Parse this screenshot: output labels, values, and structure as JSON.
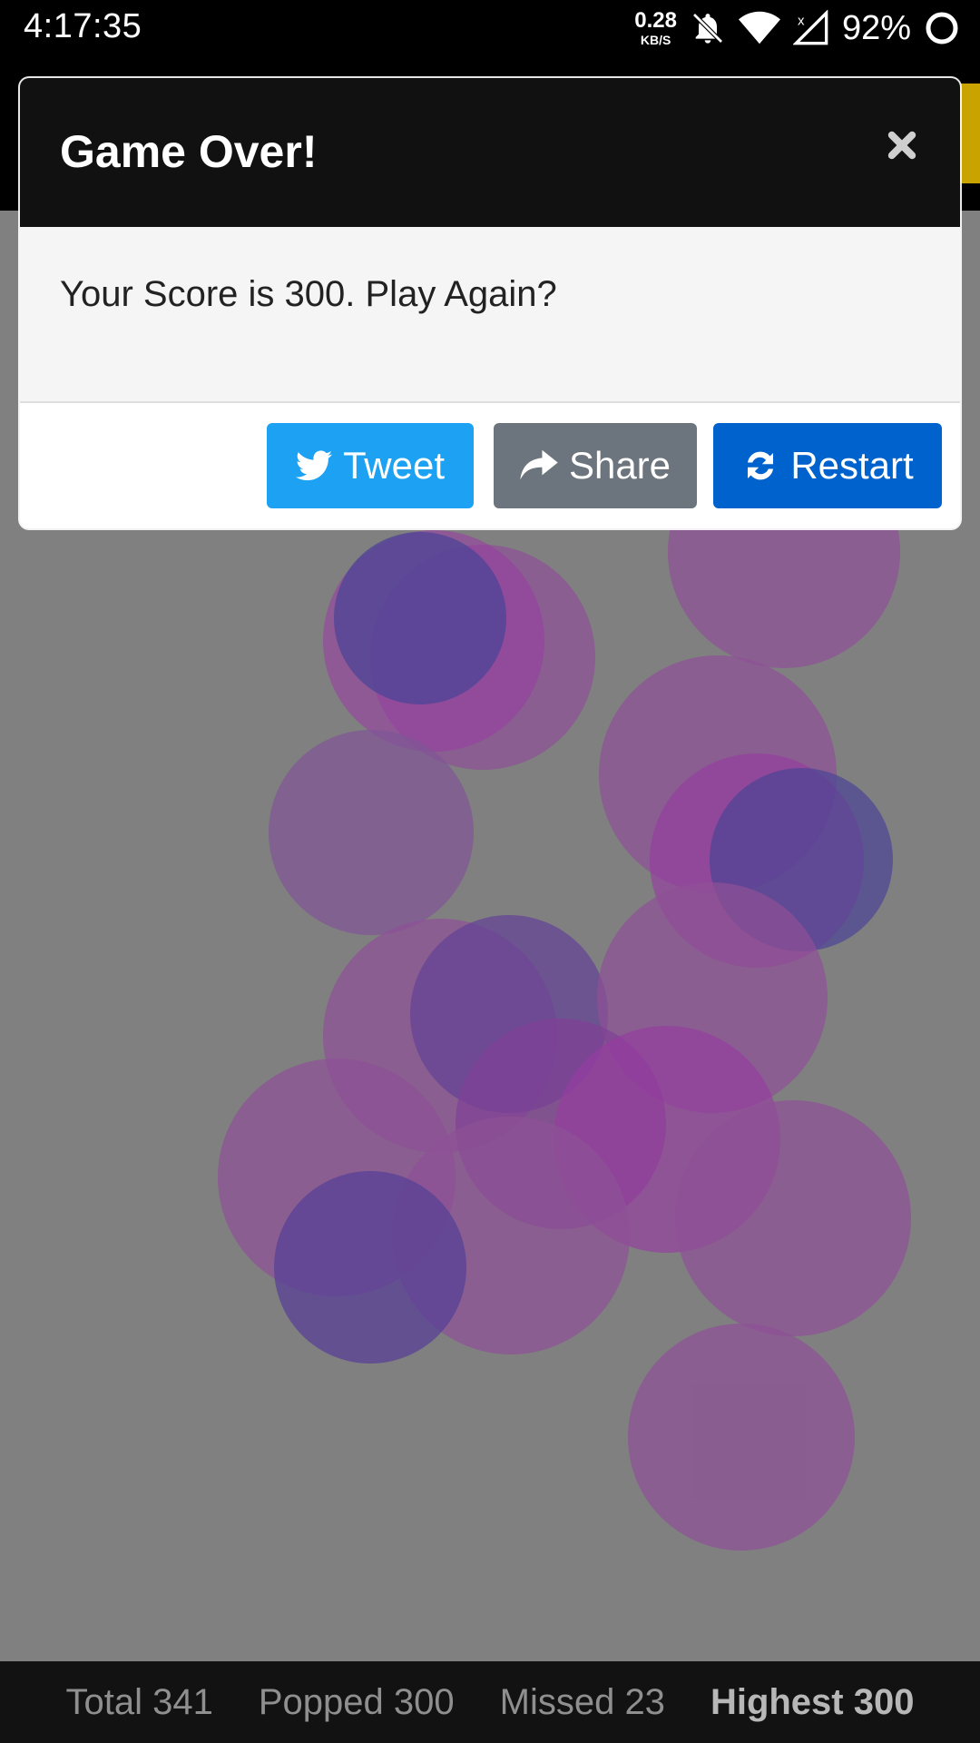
{
  "status_bar": {
    "time": "4:17:35",
    "speed_value": "0.28",
    "speed_unit": "KB/S",
    "battery": "92%",
    "icons": [
      "bell-muted-icon",
      "wifi-icon",
      "cell-signal-icon",
      "battery-ring-icon"
    ]
  },
  "modal": {
    "title": "Game Over!",
    "message": "Your Score is 300. Play Again?",
    "close_icon": "close-icon",
    "buttons": {
      "tweet": {
        "label": "Tweet",
        "icon": "twitter-icon",
        "color": "#1da1f2"
      },
      "share": {
        "label": "Share",
        "icon": "share-icon",
        "color": "#6c757d"
      },
      "restart": {
        "label": "Restart",
        "icon": "refresh-icon",
        "color": "#0062cc"
      }
    }
  },
  "stats": {
    "total": "Total 341",
    "popped": "Popped 300",
    "missed": "Missed 23",
    "highest": "Highest 300"
  },
  "colors": {
    "overlay": "#808080",
    "balloon_purple": "#8a4a9a",
    "balloon_blue": "#4a4a9a"
  }
}
